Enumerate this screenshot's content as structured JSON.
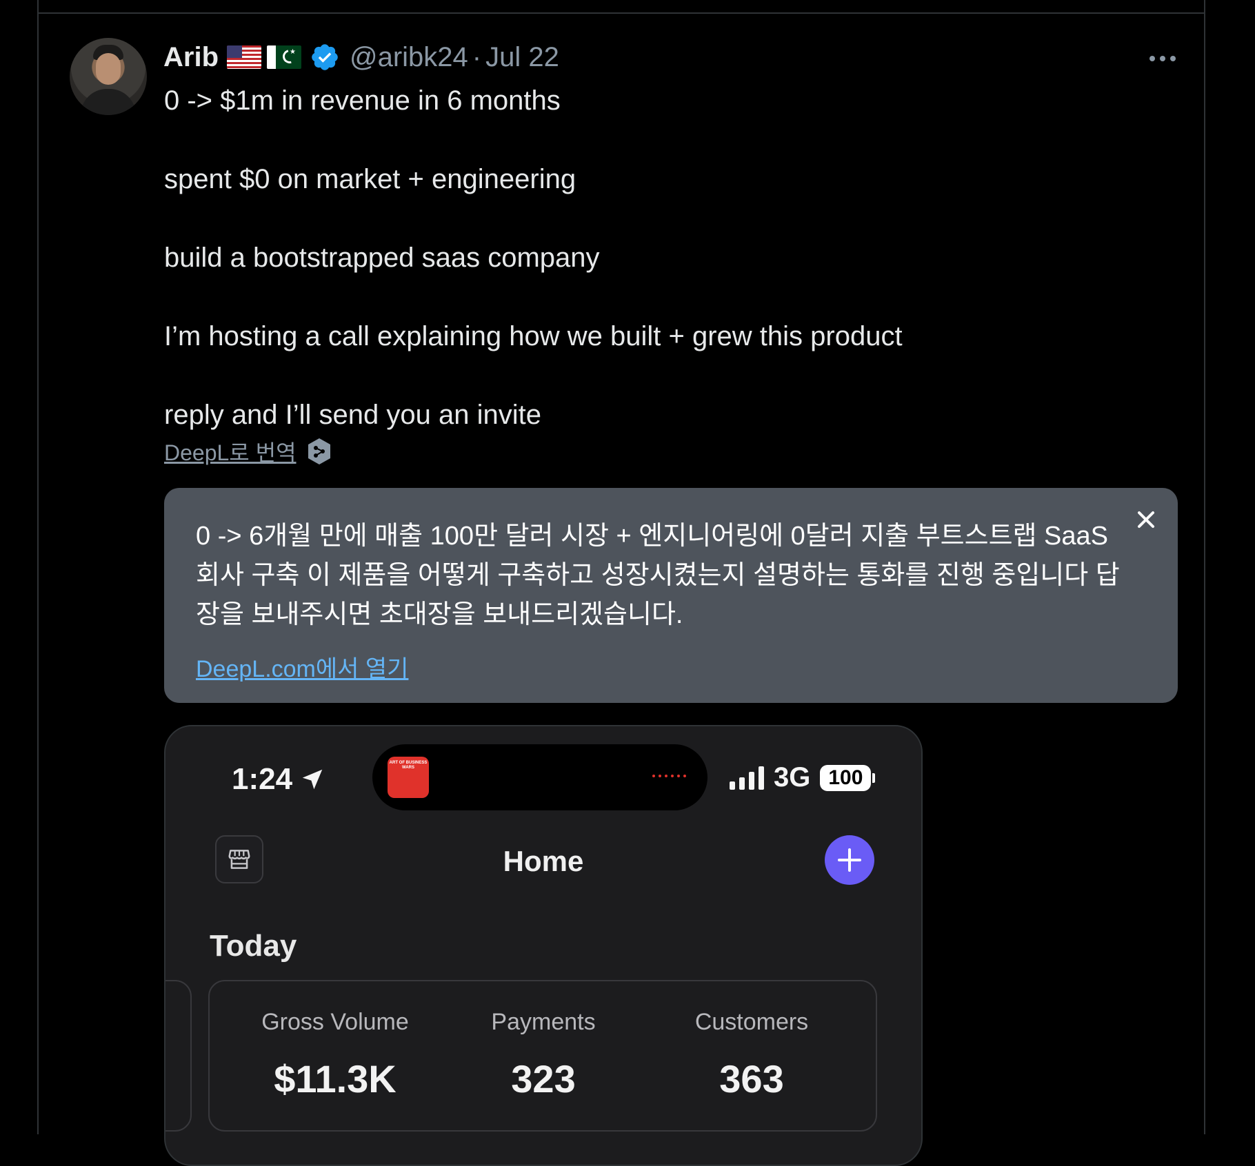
{
  "tweet": {
    "author_name": "Arib",
    "handle": "@aribk24",
    "separator": "·",
    "date": "Jul 22",
    "lines": [
      "0 -> $1m in revenue in 6 months",
      "spent $0 on market + engineering",
      "build a bootstrapped saas company",
      "I’m hosting a call explaining how we built + grew this product",
      "reply and I’ll send you an invite"
    ],
    "translate_label": "DeepL로 번역"
  },
  "translation": {
    "text": "0 -> 6개월 만에 매출 100만 달러 시장 + 엔지니어링에 0달러 지출 부트스트랩 SaaS 회사 구축 이 제품을 어떻게 구축하고 성장시켰는지 설명하는 통화를 진행 중입니다 답장을 보내주시면 초대장을 보내드리겠습니다.",
    "open_link": "DeepL.com에서 열기"
  },
  "media": {
    "status_time": "1:24",
    "network": "3G",
    "battery": "100",
    "album_art_text": "ART OF BUSINESS WARS",
    "app_title": "Home",
    "section_title": "Today",
    "stats": [
      {
        "label": "Gross Volume",
        "value": "$11.3K"
      },
      {
        "label": "Payments",
        "value": "323"
      },
      {
        "label": "Customers",
        "value": "363"
      }
    ]
  },
  "colors": {
    "background": "#000000",
    "text_primary": "#e7e9ea",
    "text_secondary": "#8b98a5",
    "verified_blue": "#1d9bf0",
    "translation_bg": "#4e545c",
    "link_blue": "#64b5f6",
    "accent_purple": "#6a5cf6"
  },
  "icons": [
    "verified-badge-icon",
    "more-options-icon",
    "deepl-logo-icon",
    "close-icon",
    "location-arrow-icon",
    "signal-bars-icon",
    "battery-icon",
    "storefront-icon",
    "plus-icon"
  ]
}
